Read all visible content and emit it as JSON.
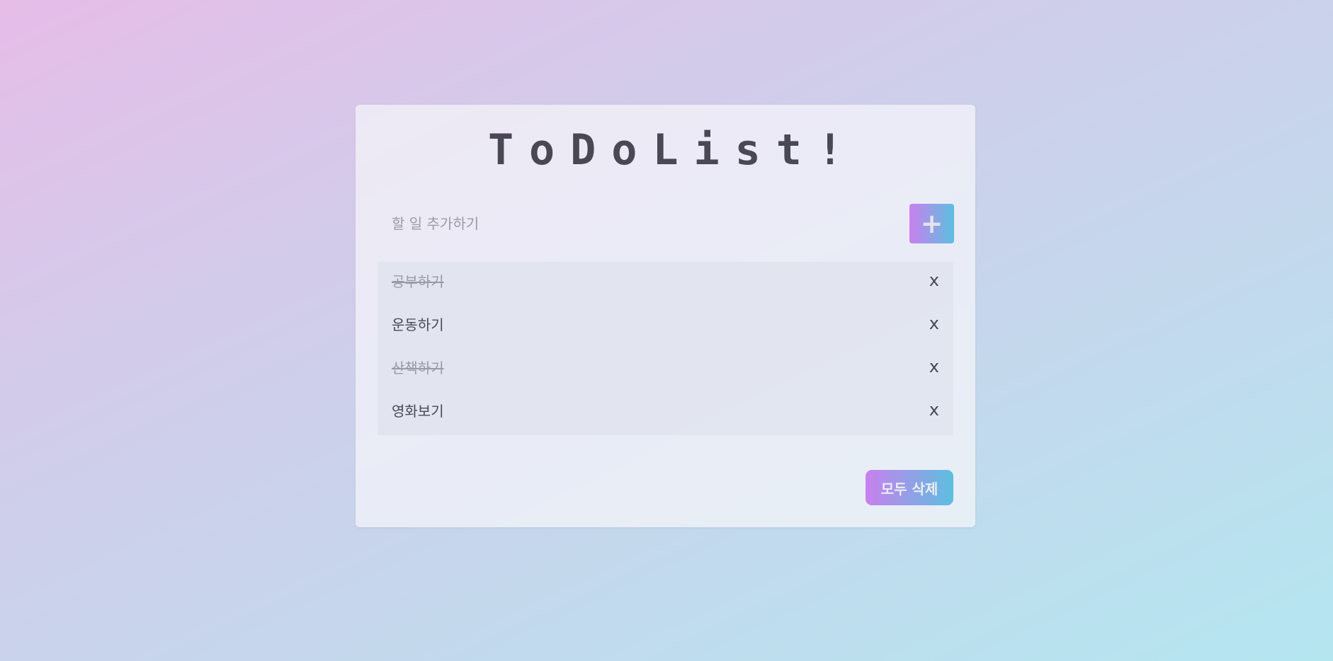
{
  "app": {
    "title": "ToDoList!"
  },
  "input": {
    "placeholder": "할 일 추가하기",
    "value": ""
  },
  "add_button": {
    "label": "+"
  },
  "todos": [
    {
      "text": "공부하기",
      "done": true,
      "delete_label": "x"
    },
    {
      "text": "운동하기",
      "done": false,
      "delete_label": "x"
    },
    {
      "text": "산책하기",
      "done": true,
      "delete_label": "x"
    },
    {
      "text": "영화보기",
      "done": false,
      "delete_label": "x"
    }
  ],
  "clear_all_button": {
    "label": "모두 삭제"
  },
  "colors": {
    "text": "#4a4855",
    "done_text": "#9c9aa8",
    "gradient_start": "#c980ee",
    "gradient_end": "#5cbfdf"
  }
}
